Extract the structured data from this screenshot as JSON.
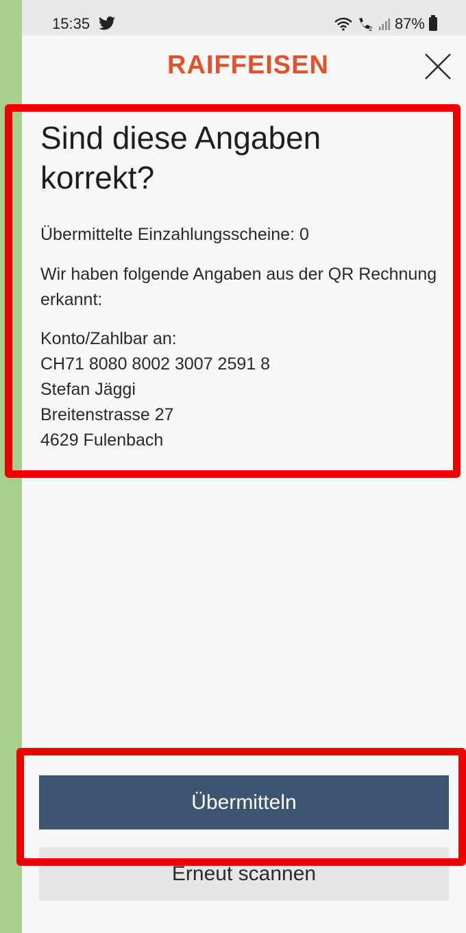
{
  "status_bar": {
    "time": "15:35",
    "battery": "87%",
    "icons": [
      "twitter-icon",
      "wifi-icon",
      "call-icon",
      "signal-icon",
      "battery-icon"
    ]
  },
  "header": {
    "brand": "RAIFFEISEN",
    "brand_color": "#e2512b",
    "close_icon": "close-icon"
  },
  "main": {
    "title": "Sind diese Angaben korrekt?",
    "transmitted_label": "Übermittelte Einzahlungsscheine: 0",
    "recognized_text": "Wir haben folgende Angaben aus der QR Rechnung erkannt:",
    "account": {
      "label": "Konto/Zahlbar an:",
      "iban": "CH71 8080 8002 3007 2591 8",
      "name": "Stefan Jäggi",
      "street": "Breitenstrasse 27",
      "city": "4629 Fulenbach"
    }
  },
  "actions": {
    "submit_label": "Übermitteln",
    "rescan_label": "Erneut scannen",
    "submit_color": "#3d5570"
  },
  "colors": {
    "highlight": "#ee0000",
    "side_strip": "#a8d08d"
  }
}
